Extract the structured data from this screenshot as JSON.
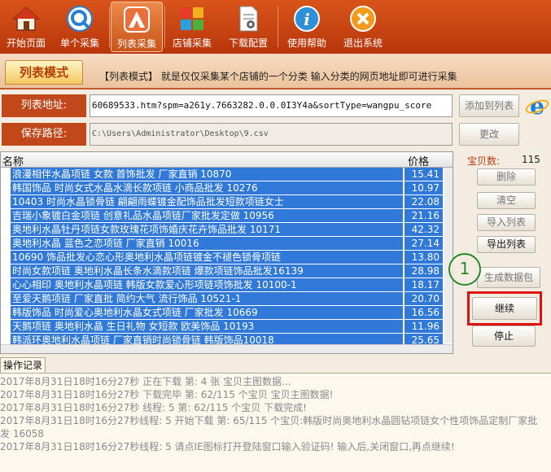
{
  "toolbar": {
    "items": [
      {
        "label": "开始页面",
        "icon": "home-icon"
      },
      {
        "label": "单个采集",
        "icon": "search-q-icon"
      },
      {
        "label": "列表采集",
        "icon": "list-collect-icon"
      },
      {
        "label": "店铺采集",
        "icon": "shop-icon"
      },
      {
        "label": "下载配置",
        "icon": "config-doc-icon"
      },
      {
        "label": "使用帮助",
        "icon": "help-icon"
      },
      {
        "label": "退出系统",
        "icon": "exit-icon"
      }
    ],
    "active_index": 2
  },
  "mode": {
    "tab_label": "列表模式",
    "description": "【列表模式】 就是仅仅采集某个店铺的一个分类 输入分类的网页地址即可进行采集"
  },
  "url_row": {
    "label": "列表地址:",
    "value": "60689533.htm?spm=a261y.7663282.0.0.0I3Y4a&sortType=wangpu_score",
    "add_button": "添加到列表"
  },
  "path_row": {
    "label": "保存路径:",
    "value": "C:\\Users\\Administrator\\Desktop\\9.csv",
    "change_button": "更改"
  },
  "list": {
    "col_name": "名称",
    "col_price": "价格",
    "rows": [
      {
        "name": "浪漫相伴水晶项链 女款 首饰批发 厂家直销 10870",
        "price": "15.41"
      },
      {
        "name": "韩国饰品 时尚女式水晶水滴长款项链 小商品批发 10276",
        "price": "10.97"
      },
      {
        "name": "10403 时尚水晶锁骨链 翩翩雨蝶镀金配饰品批发短款项链女士",
        "price": "22.08"
      },
      {
        "name": "吉瑞小象镀白金项链 创意礼品水晶项链厂家批发定做 10956",
        "price": "21.16"
      },
      {
        "name": "奥地利水晶牡丹项链女款玫瑰花项饰婚庆花卉饰品批发 10171",
        "price": "42.32"
      },
      {
        "name": "奥地利水晶 蓝色之恋项链 厂家直销 10016",
        "price": "27.14"
      },
      {
        "name": "10690 饰品批发心恋心形奥地利水晶项链镀金不褪色锁骨项链",
        "price": "13.80"
      },
      {
        "name": "时尚女款项链 奥地利水晶长条水滴款项链 爆款项链饰品批发16139",
        "price": "28.98"
      },
      {
        "name": "心心相印 奥地利水晶项链 韩版女款爱心形项链项饰批发 10100-1",
        "price": "18.17"
      },
      {
        "name": "至爱天鹅项链 厂家直批 简约大气 流行饰品 10521-1",
        "price": "20.70"
      },
      {
        "name": "韩版饰品 时尚爱心奥地利水晶女式项链 厂家批发 10669",
        "price": "16.56"
      },
      {
        "name": "天鹅项链 奥地利水晶 生日礼物 女短款 欧美饰品 10193",
        "price": "11.96"
      },
      {
        "name": "韩派环奥地利水晶项链 厂家直销时尚锁骨链 韩版饰品10018",
        "price": "25.65"
      }
    ]
  },
  "side": {
    "count_label": "宝贝数:",
    "count_value": "115",
    "delete_button": "删除",
    "clear_button": "清空",
    "import_button": "导入列表",
    "export_button": "导出列表",
    "annotation": "1",
    "generate_button": "生成数据包",
    "continue_button": "继续",
    "stop_button": "停止"
  },
  "log": {
    "tab_label": "操作记录",
    "lines": [
      "2017年8月31日18时16分27秒  正在下载 第: 4  张 宝贝主图数据...",
      "2017年8月31日18时16分27秒  下载完毕 第: 62/115  个宝贝  宝贝主图数据!",
      "2017年8月31日18时16分27秒 线程: 5  第: 62/115 个宝贝 下载完成!",
      "2017年8月31日18时16分27秒线程: 5  开始下载 第: 65/115 个宝贝:韩版时尚奥地利水晶圆钻项链女个性项饰品定制厂家批发 16058",
      "2017年8月31日18时16分27秒线程: 5  请点IE图标打开登陆窗口输入验证码! 输入后,关闭窗口,再点继续!"
    ]
  },
  "colors": {
    "toolbar": "#c8441a",
    "selection": "#3079d8",
    "highlight": "#e01010",
    "annotation": "#2a8a2a"
  }
}
